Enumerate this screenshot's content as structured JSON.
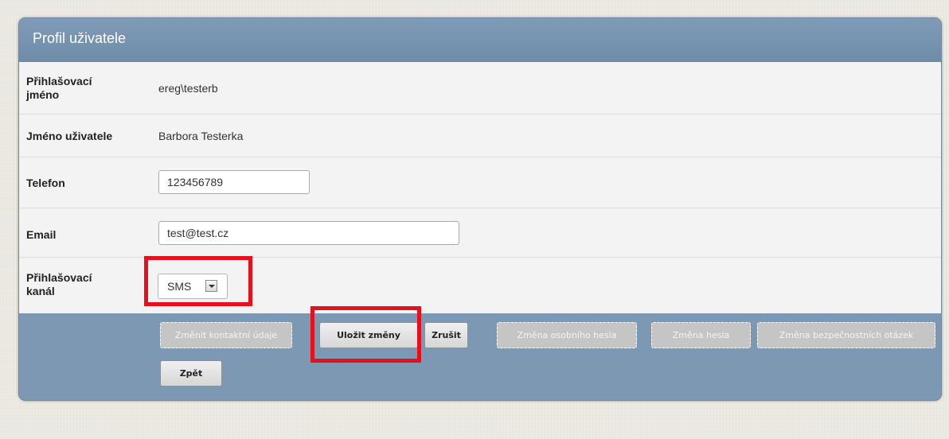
{
  "panel": {
    "title": "Profil uživatele"
  },
  "fields": {
    "login_name": {
      "label": "Přihlašovací jméno",
      "value": "ereg\\testerb"
    },
    "user_name": {
      "label": "Jméno uživatele",
      "value": "Barbora Testerka"
    },
    "phone": {
      "label": "Telefon",
      "value": "123456789"
    },
    "email": {
      "label": "Email",
      "value": "test@test.cz"
    },
    "login_channel": {
      "label": "Přihlašovací kanál",
      "selected": "SMS"
    }
  },
  "buttons": {
    "change_contact": "Změnit kontaktní údaje",
    "save": "Uložit změny",
    "cancel": "Zrušit",
    "change_personal_password": "Změna osobního hesla",
    "change_password": "Změna hesla",
    "change_security_questions": "Změna bezpečnostních otázek",
    "back": "Zpět"
  },
  "colors": {
    "highlight": "#e5101e",
    "header": "#7591ae",
    "form_background": "#f3f3f3"
  }
}
